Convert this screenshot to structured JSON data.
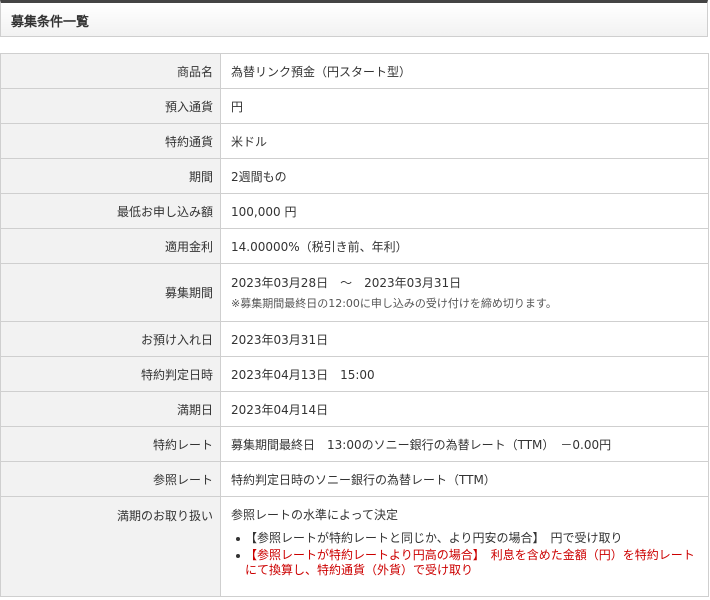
{
  "title": "募集条件一覧",
  "rows": [
    {
      "label": "商品名",
      "value": "為替リンク預金（円スタート型）"
    },
    {
      "label": "預入通貨",
      "value": "円"
    },
    {
      "label": "特約通貨",
      "value": "米ドル"
    },
    {
      "label": "期間",
      "value": "2週間もの"
    },
    {
      "label": "最低お申し込み額",
      "value": "100,000 円"
    },
    {
      "label": "適用金利",
      "value": "14.00000%（税引き前、年利）"
    },
    {
      "label": "募集期間",
      "value": "2023年03月28日　～　2023年03月31日",
      "note": "※募集期間最終日の12:00に申し込みの受け付けを締め切ります。"
    },
    {
      "label": "お預け入れ日",
      "value": "2023年03月31日"
    },
    {
      "label": "特約判定日時",
      "value": "2023年04月13日　15:00"
    },
    {
      "label": "満期日",
      "value": "2023年04月14日"
    },
    {
      "label": "特約レート",
      "value": "募集期間最終日　13:00のソニー銀行の為替レート（TTM）　－0.00円"
    },
    {
      "label": "参照レート",
      "value": "特約判定日時のソニー銀行の為替レート（TTM）"
    },
    {
      "label": "満期のお取り扱い",
      "value": "参照レートの水準によって決定",
      "bullets": [
        {
          "text": "【参照レートが特約レートと同じか、より円安の場合】　円で受け取り",
          "color": "#333333"
        },
        {
          "text_line1": "【参照レートが特約レートより円高の場合】　利息を含めた金額（円）を特約レート",
          "text_line2": "にて換算し、特約通貨（外貨）で受け取り",
          "color": "#cc0000"
        }
      ]
    }
  ]
}
